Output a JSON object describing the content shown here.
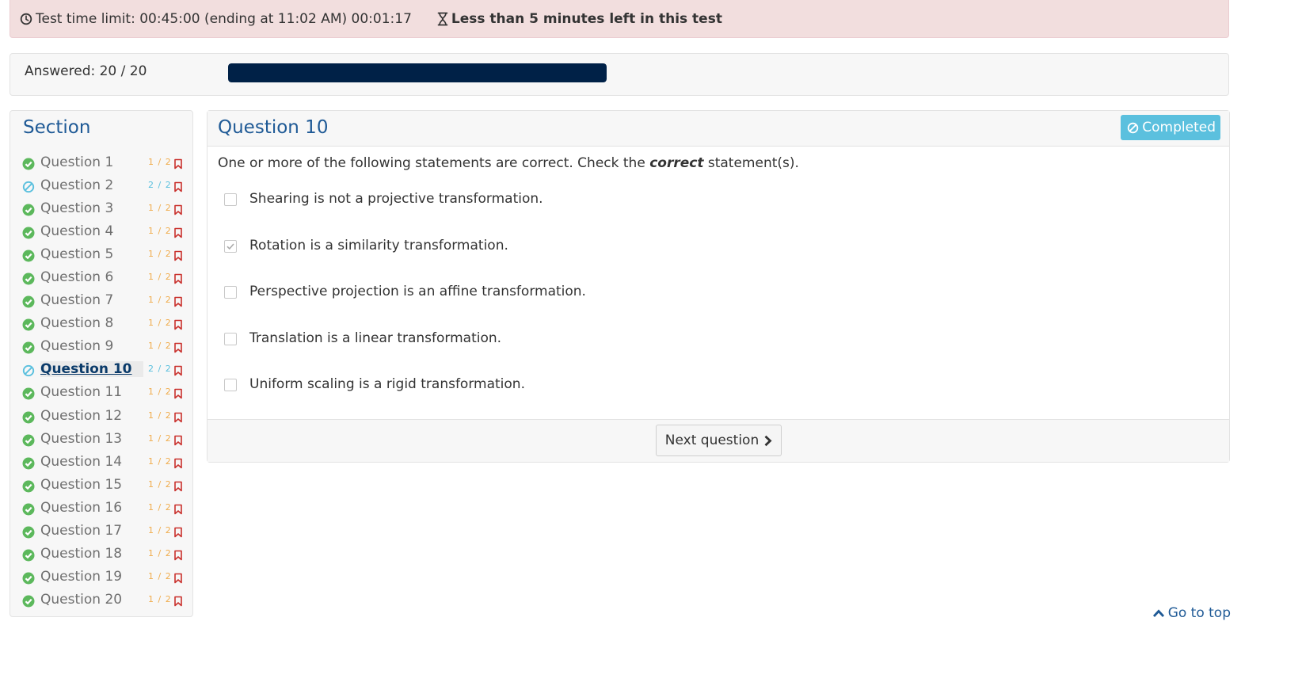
{
  "alert": {
    "time_limit_text": "Test time limit: 00:45:00 (ending at 11:02 AM) 00:01:17",
    "warning_text": "Less than 5 minutes left in this test"
  },
  "progress": {
    "answered_text": "Answered: 20 / 20",
    "answered": 20,
    "total": 20,
    "fraction": 1.0
  },
  "sidebar": {
    "title": "Section",
    "questions": [
      {
        "label": "Question 1",
        "score": "1 / 2",
        "status": "check-circle-icon"
      },
      {
        "label": "Question 2",
        "score": "2 / 2",
        "status": "ban-icon"
      },
      {
        "label": "Question 3",
        "score": "1 / 2",
        "status": "check-circle-icon"
      },
      {
        "label": "Question 4",
        "score": "1 / 2",
        "status": "check-circle-icon"
      },
      {
        "label": "Question 5",
        "score": "1 / 2",
        "status": "check-circle-icon"
      },
      {
        "label": "Question 6",
        "score": "1 / 2",
        "status": "check-circle-icon"
      },
      {
        "label": "Question 7",
        "score": "1 / 2",
        "status": "check-circle-icon"
      },
      {
        "label": "Question 8",
        "score": "1 / 2",
        "status": "check-circle-icon"
      },
      {
        "label": "Question 9",
        "score": "1 / 2",
        "status": "check-circle-icon"
      },
      {
        "label": "Question 10",
        "score": "2 / 2",
        "status": "ban-icon",
        "current": true
      },
      {
        "label": "Question 11",
        "score": "1 / 2",
        "status": "check-circle-icon"
      },
      {
        "label": "Question 12",
        "score": "1 / 2",
        "status": "check-circle-icon"
      },
      {
        "label": "Question 13",
        "score": "1 / 2",
        "status": "check-circle-icon"
      },
      {
        "label": "Question 14",
        "score": "1 / 2",
        "status": "check-circle-icon"
      },
      {
        "label": "Question 15",
        "score": "1 / 2",
        "status": "check-circle-icon"
      },
      {
        "label": "Question 16",
        "score": "1 / 2",
        "status": "check-circle-icon"
      },
      {
        "label": "Question 17",
        "score": "1 / 2",
        "status": "check-circle-icon"
      },
      {
        "label": "Question 18",
        "score": "1 / 2",
        "status": "check-circle-icon"
      },
      {
        "label": "Question 19",
        "score": "1 / 2",
        "status": "check-circle-icon"
      },
      {
        "label": "Question 20",
        "score": "1 / 2",
        "status": "check-circle-icon"
      }
    ]
  },
  "question": {
    "title": "Question 10",
    "badge": "Completed",
    "prompt_before": "One or more of the following statements are correct. Check the ",
    "prompt_emphasis": "correct",
    "prompt_after": " statement(s).",
    "options": [
      {
        "text": "Shearing is not a projective transformation.",
        "checked": false
      },
      {
        "text": "Rotation is a similarity transformation.",
        "checked": true
      },
      {
        "text": "Perspective projection is an affine transformation.",
        "checked": false
      },
      {
        "text": "Translation is a linear transformation.",
        "checked": false
      },
      {
        "text": "Uniform scaling is a rigid transformation.",
        "checked": false
      }
    ],
    "next_label": "Next question"
  },
  "footer": {
    "go_top_label": "Go to top"
  },
  "colors": {
    "alert_bg": "#f2dede",
    "progress_fill": "#002147",
    "heading_blue": "#1f5a96",
    "success_green": "#5cb85c",
    "info_blue": "#5bc0de",
    "partial_orange": "#f0ad4e",
    "flag_red": "#c9302c"
  }
}
